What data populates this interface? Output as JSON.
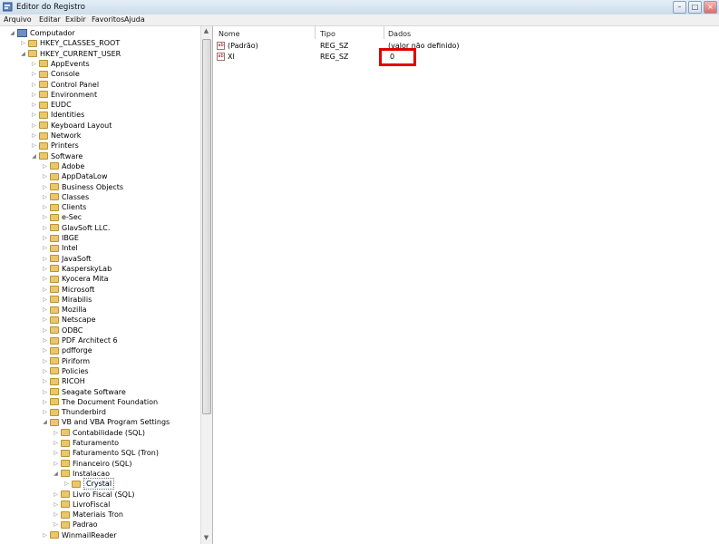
{
  "window": {
    "title": "Editor do Registro"
  },
  "menu": [
    "Arquivo",
    "Editar",
    "Exibir",
    "Favoritos",
    "Ajuda"
  ],
  "tree": [
    {
      "label": "Computador",
      "level": 0,
      "expanded": true,
      "type": "computer"
    },
    {
      "label": "HKEY_CLASSES_ROOT",
      "level": 1,
      "expanded": false
    },
    {
      "label": "HKEY_CURRENT_USER",
      "level": 1,
      "expanded": true
    },
    {
      "label": "AppEvents",
      "level": 2,
      "expanded": false
    },
    {
      "label": "Console",
      "level": 2,
      "expanded": false
    },
    {
      "label": "Control Panel",
      "level": 2,
      "expanded": false
    },
    {
      "label": "Environment",
      "level": 2,
      "expanded": false
    },
    {
      "label": "EUDC",
      "level": 2,
      "expanded": false
    },
    {
      "label": "Identities",
      "level": 2,
      "expanded": false
    },
    {
      "label": "Keyboard Layout",
      "level": 2,
      "expanded": false
    },
    {
      "label": "Network",
      "level": 2,
      "expanded": false
    },
    {
      "label": "Printers",
      "level": 2,
      "expanded": false
    },
    {
      "label": "Software",
      "level": 2,
      "expanded": true
    },
    {
      "label": "Adobe",
      "level": 3,
      "expanded": false
    },
    {
      "label": "AppDataLow",
      "level": 3,
      "expanded": false
    },
    {
      "label": "Business Objects",
      "level": 3,
      "expanded": false
    },
    {
      "label": "Classes",
      "level": 3,
      "expanded": false
    },
    {
      "label": "Clients",
      "level": 3,
      "expanded": false
    },
    {
      "label": "e-Sec",
      "level": 3,
      "expanded": false
    },
    {
      "label": "GlavSoft LLC.",
      "level": 3,
      "expanded": false
    },
    {
      "label": "IBGE",
      "level": 3,
      "expanded": false
    },
    {
      "label": "Intel",
      "level": 3,
      "expanded": false
    },
    {
      "label": "JavaSoft",
      "level": 3,
      "expanded": false
    },
    {
      "label": "KasperskyLab",
      "level": 3,
      "expanded": false
    },
    {
      "label": "Kyocera Mita",
      "level": 3,
      "expanded": false
    },
    {
      "label": "Microsoft",
      "level": 3,
      "expanded": false
    },
    {
      "label": "Mirabilis",
      "level": 3,
      "expanded": false
    },
    {
      "label": "Mozilla",
      "level": 3,
      "expanded": false
    },
    {
      "label": "Netscape",
      "level": 3,
      "expanded": false
    },
    {
      "label": "ODBC",
      "level": 3,
      "expanded": false
    },
    {
      "label": "PDF Architect 6",
      "level": 3,
      "expanded": false
    },
    {
      "label": "pdfforge",
      "level": 3,
      "expanded": false
    },
    {
      "label": "Piriform",
      "level": 3,
      "expanded": false
    },
    {
      "label": "Policies",
      "level": 3,
      "expanded": false
    },
    {
      "label": "RICOH",
      "level": 3,
      "expanded": false
    },
    {
      "label": "Seagate Software",
      "level": 3,
      "expanded": false
    },
    {
      "label": "The Document Foundation",
      "level": 3,
      "expanded": false
    },
    {
      "label": "Thunderbird",
      "level": 3,
      "expanded": false
    },
    {
      "label": "VB and VBA Program Settings",
      "level": 3,
      "expanded": true
    },
    {
      "label": "Contabilidade (SQL)",
      "level": 4,
      "expanded": false
    },
    {
      "label": "Faturamento",
      "level": 4,
      "expanded": false
    },
    {
      "label": "Faturamento SQL (Tron)",
      "level": 4,
      "expanded": false
    },
    {
      "label": "Financeiro (SQL)",
      "level": 4,
      "expanded": false
    },
    {
      "label": "Instalacao",
      "level": 4,
      "expanded": true
    },
    {
      "label": "Crystal",
      "level": 5,
      "expanded": false,
      "selected": true
    },
    {
      "label": "Livro Fiscal (SQL)",
      "level": 4,
      "expanded": false
    },
    {
      "label": "LivroFiscal",
      "level": 4,
      "expanded": false
    },
    {
      "label": "Materiais Tron",
      "level": 4,
      "expanded": false
    },
    {
      "label": "Padrao",
      "level": 4,
      "expanded": false
    },
    {
      "label": "WinmailReader",
      "level": 3,
      "expanded": false
    }
  ],
  "list": {
    "columns": [
      "Nome",
      "Tipo",
      "Dados"
    ],
    "rows": [
      {
        "name": "(Padrão)",
        "type": "REG_SZ",
        "data": "(valor não definido)"
      },
      {
        "name": "XI",
        "type": "REG_SZ",
        "data": "0"
      }
    ]
  }
}
